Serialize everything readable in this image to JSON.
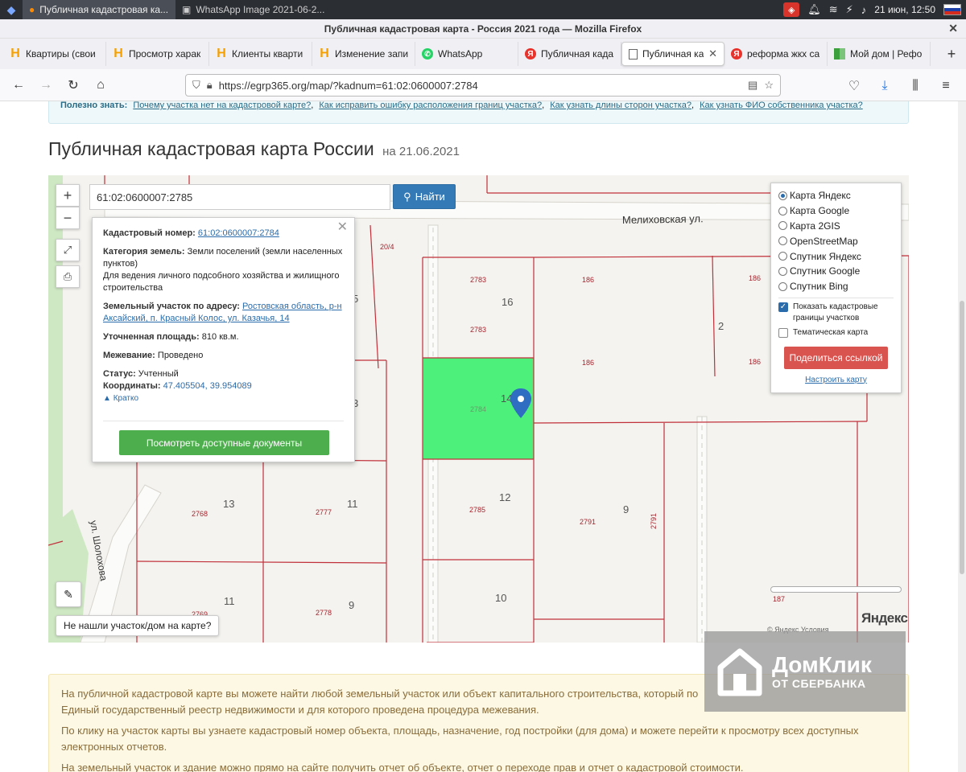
{
  "taskbar": {
    "task1": "Публичная кадастровая ка...",
    "task2": "WhatsApp Image 2021-06-2...",
    "clock": "21 июн, 12:50"
  },
  "window": {
    "title": "Публичная кадастровая карта - Россия 2021 года — Mozilla Firefox"
  },
  "tabs": [
    {
      "label": "Квартиры (свои"
    },
    {
      "label": "Просмотр харак"
    },
    {
      "label": "Клиенты кварти"
    },
    {
      "label": "Изменение запи"
    },
    {
      "label": "WhatsApp"
    },
    {
      "label": "Публичная када"
    },
    {
      "label": "Публичная ка"
    },
    {
      "label": "реформа жкх са"
    },
    {
      "label": "Мой дом | Рефо"
    }
  ],
  "navbar": {
    "url": "https://egrp365.org/map/?kadnum=61:02:0600007:2784"
  },
  "info": {
    "label": "Полезно знать:",
    "links": [
      "Почему участка нет на кадастровой карте?",
      "Как исправить ошибку расположения границ участка?",
      "Как узнать длины сторон участка?",
      "Как узнать ФИО собственника участка?"
    ]
  },
  "page": {
    "title": "Публичная кадастровая карта России",
    "date": "на 21.06.2021"
  },
  "map": {
    "search_value": "61:02:0600007:2785",
    "search_button": "Найти",
    "zoom_in": "+",
    "zoom_out": "−",
    "street1": "Мелиховская ул.",
    "street2": "ул. Шолохова",
    "not_found": "Не нашли участок/дом на карте?",
    "yandex": "Яндекс",
    "copyright": "© Яндекс  Условия",
    "labels": {
      "l20_4": "20/4",
      "l2783a": "2783",
      "l16": "16",
      "l2783b": "2783",
      "l186a": "186",
      "l186b": "186",
      "l186c": "186",
      "l186d": "186",
      "l2": "2",
      "l2784": "2784",
      "l14": "14",
      "l5": "5",
      "l3": "3",
      "l13": "13",
      "l2768": "2768",
      "l11a": "11",
      "l2777": "2777",
      "l2785": "2785",
      "l12": "12",
      "l9a": "9",
      "l2791a": "2791",
      "l2791b": "2791",
      "l11b": "11",
      "l2769": "2769",
      "l9b": "9",
      "l2778": "2778",
      "l10": "10",
      "l187": "187"
    }
  },
  "popup": {
    "cad_label": "Кадастровый номер:",
    "cad_value": "61:02:0600007:2784",
    "cat_label": "Категория земель:",
    "cat_value": "Земли поселений (земли населенных пунктов)",
    "use_value": "Для ведения личного подсобного хозяйства и жилищного строительства",
    "addr_label": "Земельный участок по адресу:",
    "addr_value": "Ростовская область, р-н Аксайский, п. Красный Колос, ул. Казачья, 14",
    "area_label": "Уточненная площадь:",
    "area_value": "810 кв.м.",
    "survey_label": "Межевание:",
    "survey_value": "Проведено",
    "status_label": "Статус:",
    "status_value": "Учтенный",
    "coords_label": "Координаты:",
    "coords_value": "47.405504, 39.954089",
    "short_link": "Кратко",
    "docs_button": "Посмотреть доступные документы"
  },
  "layers": {
    "items": [
      {
        "label": "Карта Яндекс",
        "selected": true
      },
      {
        "label": "Карта Google",
        "selected": false
      },
      {
        "label": "Карта 2GIS",
        "selected": false
      },
      {
        "label": "OpenStreetMap",
        "selected": false
      },
      {
        "label": "Спутник Яндекс",
        "selected": false
      },
      {
        "label": "Спутник Google",
        "selected": false
      },
      {
        "label": "Спутник Bing",
        "selected": false
      }
    ],
    "show_borders": "Показать кадастровые границы участков",
    "thematic": "Тематическая карта",
    "share_button": "Поделиться ссылкой",
    "configure_link": "Настроить карту"
  },
  "watermark": {
    "brand": "ДомКлик",
    "sub": "ОТ СБЕРБАНКА"
  },
  "bottom": {
    "p1": "На публичной кадастровой карте вы можете найти любой земельный участок или объект капитального строительства, который по",
    "p1b": "Единый государственный реестр недвижимости и для которого проведена процедура межевания.",
    "p2": "По клику на участок карты вы узнаете кадастровый номер объекта, площадь, назначение, год постройки (для дома) и можете перейти к просмотру всех доступных электронных отчетов.",
    "p3": "На земельный участок и здание можно прямо на сайте получить отчет об объекте, отчет о переходе прав и отчет о кадастровой стоимости."
  },
  "colors": {
    "selected_parcel": "#4cf07a",
    "boundary": "#c0303a",
    "search_button": "#337ab7",
    "docs_button": "#4cae4c",
    "share_button": "#d9534f"
  }
}
